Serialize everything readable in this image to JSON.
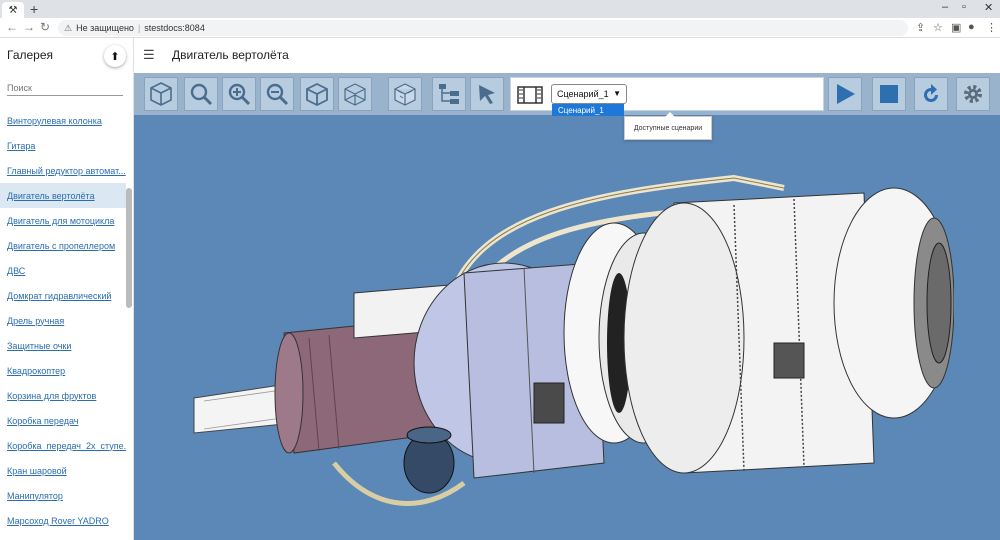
{
  "browser": {
    "url_warning": "Не защищено",
    "url": "stestdocs:8084"
  },
  "sidebar": {
    "title": "Галерея",
    "search_placeholder": "Поиск",
    "items": [
      "Винторулевая колонка",
      "Гитара",
      "Главный редуктор автомат...",
      "Двигатель вертолёта",
      "Двигатель для мотоцикла",
      "Двигатель с пропеллером",
      "ДВС",
      "Домкрат гидравлический",
      "Дрель ручная",
      "Защитные очки",
      "Квадрокоптер",
      "Корзина для фруктов",
      "Коробка передач",
      "Коробка_передач_2х_ступе...",
      "Кран шаровой",
      "Манипулятор",
      "Марсоход Rover YADRO"
    ],
    "active_index": 3
  },
  "header": {
    "title": "Двигатель вертолёта"
  },
  "scenario": {
    "selected": "Сценарий_1",
    "options": [
      "Сценарий_1"
    ],
    "tooltip": "Доступные сценарии"
  },
  "colors": {
    "viewport_bg": "#5b88b7",
    "toolbar_bg": "#9ab3cd",
    "accent": "#1e78d7",
    "link": "#2a6db0"
  }
}
